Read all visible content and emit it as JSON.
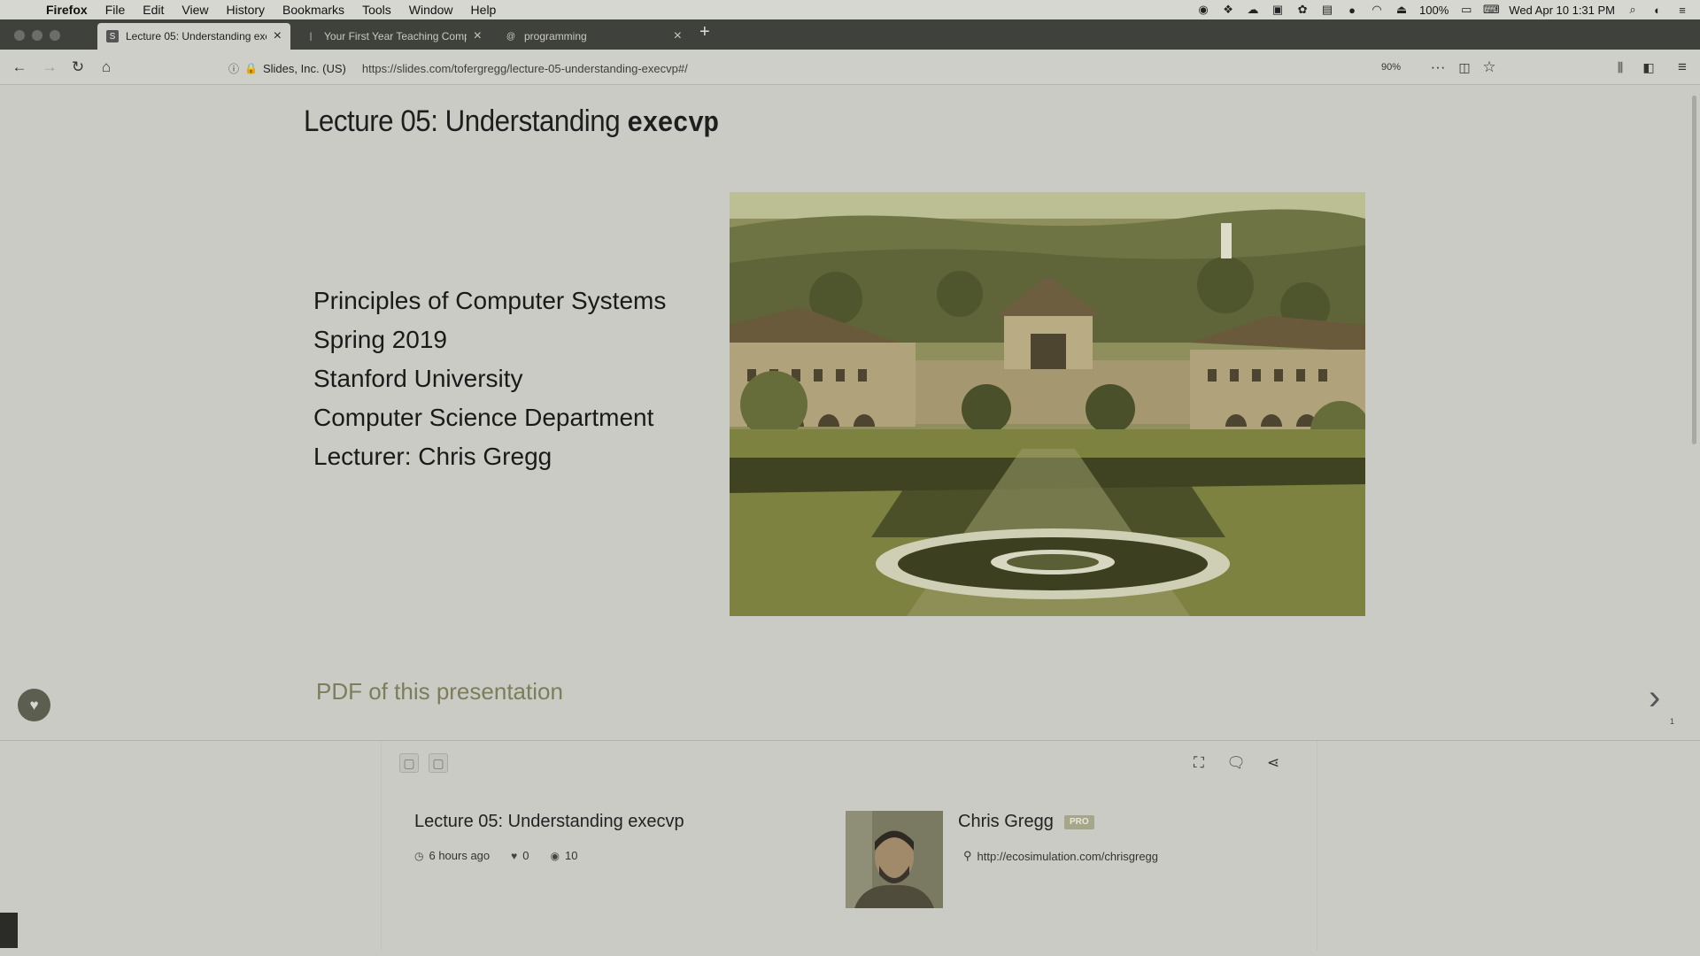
{
  "menubar": {
    "apple": "",
    "app": "Firefox",
    "items": [
      "File",
      "Edit",
      "View",
      "History",
      "Bookmarks",
      "Tools",
      "Window",
      "Help"
    ],
    "battery": "100%",
    "clock": "Wed Apr 10  1:31 PM"
  },
  "tabs": [
    {
      "title": "Lecture 05: Understanding exe",
      "favicon": "S",
      "active": true
    },
    {
      "title": "Your First Year Teaching Comp",
      "favicon": "|",
      "active": false
    },
    {
      "title": "programming",
      "favicon": "@",
      "active": false
    }
  ],
  "navbar": {
    "site_identity": "Slides, Inc. (US)",
    "url": "https://slides.com/tofergregg/lecture-05-understanding-execvp#/",
    "zoom": "90%"
  },
  "slide": {
    "title_prefix": "Lecture 05: Understanding ",
    "title_code": "execvp",
    "lines": [
      "Principles of Computer Systems",
      "Spring 2019",
      "Stanford University",
      "Computer Science Department",
      "Lecturer: Chris Gregg"
    ],
    "pdf_link": "PDF of this presentation",
    "slide_number": "1"
  },
  "deck": {
    "title": "Lecture 05: Understanding execvp",
    "updated": "6 hours ago",
    "likes": "0",
    "views": "10"
  },
  "author": {
    "name": "Chris Gregg",
    "badge": "PRO",
    "link": "http://ecosimulation.com/chrisgregg"
  },
  "colors": {
    "page_bg": "#cbcbc6",
    "tabstrip_bg": "#3f413d",
    "link_color": "#7c7d5a",
    "sky": "#bcbf94",
    "lawn": "#7d8240"
  }
}
